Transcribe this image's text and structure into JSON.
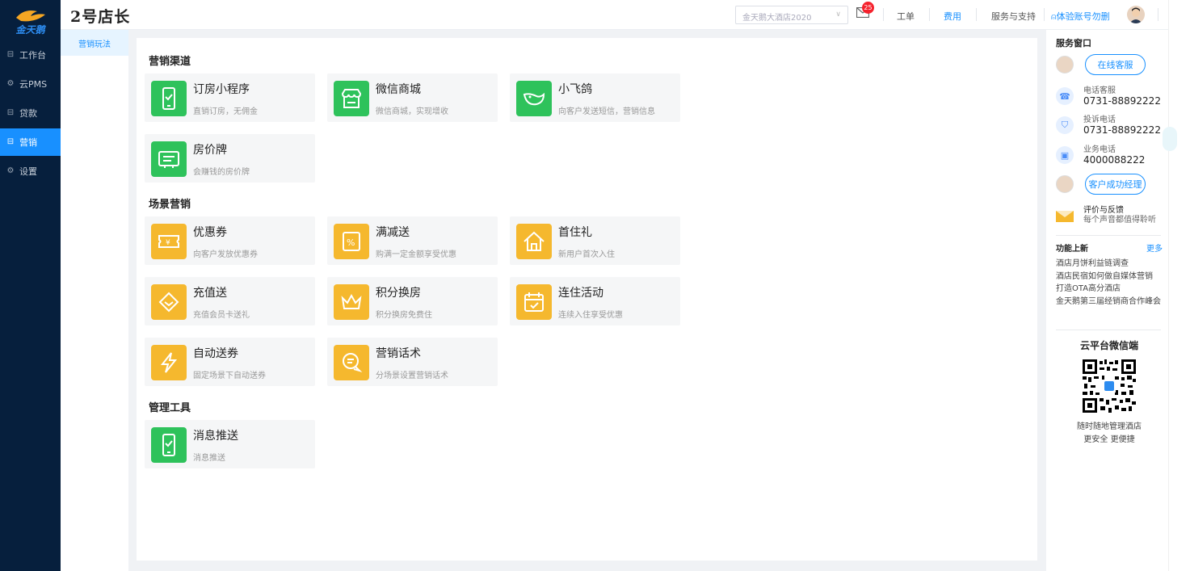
{
  "app": {
    "logo_text": "金天鹅",
    "brand": "2号店长"
  },
  "sidebar": {
    "items": [
      {
        "label": "工作台",
        "icon": "workbench-icon"
      },
      {
        "label": "云PMS",
        "icon": "cloud-icon"
      },
      {
        "label": "贷款",
        "icon": "loan-icon"
      },
      {
        "label": "营销",
        "icon": "marketing-icon",
        "active": true
      },
      {
        "label": "设置",
        "icon": "gear-icon"
      }
    ]
  },
  "subnav": {
    "items": [
      {
        "label": "营销玩法",
        "active": true
      }
    ]
  },
  "header": {
    "hotel_select": "金天鹅大酒店2020",
    "message_count": "25",
    "links": [
      "工单",
      "费用",
      "服务与支持"
    ],
    "user": "体验账号勿删"
  },
  "sections": [
    {
      "title": "营销渠道",
      "cards": [
        {
          "title": "订房小程序",
          "desc": "直销订房，无佣金",
          "icon": "phone-check-icon",
          "color": "green"
        },
        {
          "title": "微信商城",
          "desc": "微信商城，实现增收",
          "icon": "shop-icon",
          "color": "green"
        },
        {
          "title": "小飞鸽",
          "desc": "向客户发送短信，营销信息",
          "icon": "bird-icon",
          "color": "green"
        },
        {
          "title": "房价牌",
          "desc": "会赚钱的房价牌",
          "icon": "price-board-icon",
          "color": "green"
        }
      ]
    },
    {
      "title": "场景营销",
      "cards": [
        {
          "title": "优惠券",
          "desc": "向客户发放优惠券",
          "icon": "coupon-icon",
          "color": "orange"
        },
        {
          "title": "满减送",
          "desc": "购满一定金额享受优惠",
          "icon": "percent-icon",
          "color": "orange"
        },
        {
          "title": "首住礼",
          "desc": "新用户首次入住",
          "icon": "home-icon",
          "color": "orange"
        },
        {
          "title": "充值送",
          "desc": "充值会员卡送礼",
          "icon": "diamond-icon",
          "color": "orange"
        },
        {
          "title": "积分换房",
          "desc": "积分换房免费住",
          "icon": "crown-icon",
          "color": "orange"
        },
        {
          "title": "连住活动",
          "desc": "连续入住享受优惠",
          "icon": "calendar-check-icon",
          "color": "orange"
        },
        {
          "title": "自动送券",
          "desc": "固定场景下自动送券",
          "icon": "lightning-icon",
          "color": "orange"
        },
        {
          "title": "营销话术",
          "desc": "分场景设置营销话术",
          "icon": "chat-icon",
          "color": "orange"
        }
      ]
    },
    {
      "title": "管理工具",
      "cards": [
        {
          "title": "消息推送",
          "desc": "消息推送",
          "icon": "phone-check-icon",
          "color": "green"
        }
      ]
    }
  ],
  "service": {
    "title": "服务窗口",
    "online_service": "在线客服",
    "phone_label": "电话客服",
    "phone": "0731-88892222",
    "complaint_label": "投诉电话",
    "complaint": "0731-88892222",
    "business_label": "业务电话",
    "business": "4000088222",
    "manager": "客户成功经理",
    "feedback_title": "评价与反馈",
    "feedback_sub": "每个声音都值得聆听"
  },
  "news": {
    "title": "功能上新",
    "more": "更多",
    "items": [
      "酒店月饼利益链调查",
      "酒店民宿如何做自媒体营销",
      "打造OTA高分酒店",
      "金天鹅第三届经销商合作峰会"
    ]
  },
  "wechat": {
    "title": "云平台微信端",
    "line1": "随时随地管理酒店",
    "line2": "更安全 更便捷"
  },
  "colors": {
    "green": "#2ec25b",
    "orange": "#f5b82e",
    "primary": "#1890ff",
    "nav_bg": "#061f3d"
  }
}
